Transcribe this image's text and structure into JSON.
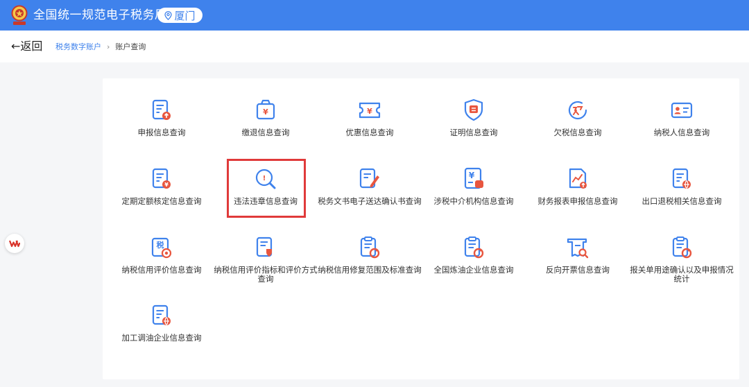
{
  "header": {
    "title": "全国统一规范电子税务局",
    "region": "厦门",
    "emblem_icon": "tax-emblem",
    "bg_color": "#3f82ec"
  },
  "nav": {
    "back_label": "←返回",
    "breadcrumb": {
      "parent": "税务数字账户",
      "separator": "›",
      "current": "账户查询"
    }
  },
  "tiles": [
    {
      "label": "申报信息查询",
      "icon": "document-upload-icon"
    },
    {
      "label": "缴退信息查询",
      "icon": "yuan-bag-icon"
    },
    {
      "label": "优惠信息查询",
      "icon": "yuan-ticket-icon"
    },
    {
      "label": "证明信息查询",
      "icon": "certificate-shield-icon"
    },
    {
      "label": "欠税信息查询",
      "icon": "owed-tax-icon"
    },
    {
      "label": "纳税人信息查询",
      "icon": "id-card-icon"
    },
    {
      "label": "定期定额核定信息查询",
      "icon": "document-yuan-icon"
    },
    {
      "label": "违法违章信息查询",
      "icon": "violation-search-icon"
    },
    {
      "label": "税务文书电子送达确认书查询",
      "icon": "document-pen-icon"
    },
    {
      "label": "涉税中介机构信息查询",
      "icon": "agency-document-icon"
    },
    {
      "label": "财务报表申报信息查询",
      "icon": "financial-report-icon"
    },
    {
      "label": "出口退税相关信息查询",
      "icon": "document-globe-icon"
    },
    {
      "label": "纳税信用评价信息查询",
      "icon": "tax-credit-icon"
    },
    {
      "label": "纳税信用评价指标和评价方式查询",
      "icon": "credit-index-icon"
    },
    {
      "label": "纳税信用修复范围及标准查询",
      "icon": "clipboard-refresh-icon"
    },
    {
      "label": "全国炼油企业信息查询",
      "icon": "clipboard-refresh-icon"
    },
    {
      "label": "反向开票信息查询",
      "icon": "invoice-search-icon"
    },
    {
      "label": "报关单用途确认以及申报情况统计",
      "icon": "clipboard-refresh-icon"
    },
    {
      "label": "加工调油企业信息查询",
      "icon": "document-globe-icon"
    }
  ],
  "highlighted_tile_index": 7,
  "colors": {
    "accent": "#3f82ec",
    "icon_red": "#e8563f",
    "highlight": "#e03a3a"
  },
  "side_widget": {
    "icon": "wps-logo-icon"
  }
}
